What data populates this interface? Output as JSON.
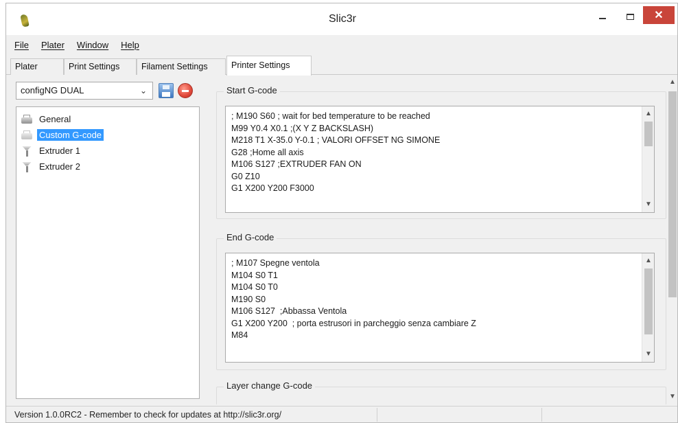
{
  "window": {
    "title": "Slic3r",
    "close_glyph": "✕"
  },
  "menu": [
    {
      "label": "File"
    },
    {
      "label": "Plater"
    },
    {
      "label": "Window"
    },
    {
      "label": "Help"
    }
  ],
  "tabs": [
    {
      "label": "Plater",
      "active": false
    },
    {
      "label": "Print Settings",
      "active": false
    },
    {
      "label": "Filament Settings",
      "active": false
    },
    {
      "label": "Printer Settings",
      "active": true
    }
  ],
  "preset": {
    "selected": "configNG DUAL",
    "chevron": "⌄"
  },
  "tree": [
    {
      "label": "General",
      "icon": "printer-icon",
      "selected": false
    },
    {
      "label": "Custom G-code",
      "icon": "printer-icon",
      "selected": true
    },
    {
      "label": "Extruder 1",
      "icon": "funnel-icon",
      "selected": false
    },
    {
      "label": "Extruder 2",
      "icon": "funnel-icon",
      "selected": false
    }
  ],
  "sections": {
    "start_gcode": {
      "label": "Start G-code",
      "lines": [
        "; M190 S60 ; wait for bed temperature to be reached",
        "M99 Y0.4 X0.1 ;(X Y Z BACKSLASH)",
        "M218 T1 X-35.0 Y-0.1 ; VALORI OFFSET NG SIMONE",
        "G28 ;Home all axis",
        "M106 S127 ;EXTRUDER FAN ON",
        "G0 Z10",
        "G1 X200 Y200 F3000"
      ]
    },
    "end_gcode": {
      "label": "End G-code",
      "lines": [
        "; M107 Spegne ventola",
        "M104 S0 T1",
        "M104 S0 T0",
        "M190 S0",
        "M106 S127  ;Abbassa Ventola",
        "G1 X200 Y200  ; porta estrusori in parcheggio senza cambiare Z",
        "M84"
      ]
    },
    "layer_change_gcode": {
      "label": "Layer change G-code"
    }
  },
  "scroll": {
    "up": "▲",
    "down": "▼"
  },
  "status": {
    "text": "Version 1.0.0RC2 - Remember to check for updates at http://slic3r.org/"
  }
}
